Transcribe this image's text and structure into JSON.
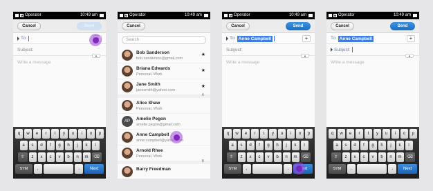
{
  "status": {
    "operator": "Operator",
    "time": "10:49 am",
    "m_badge": "M"
  },
  "topbar": {
    "cancel": "Cancel",
    "send": "Send"
  },
  "compose": {
    "to_label": "To:",
    "subject_label": "Subject:",
    "message_placeholder": "Write a message",
    "recipient_chip": "Anne Campbell",
    "plus": "+",
    "expand": "▼"
  },
  "search": {
    "placeholder": "Search"
  },
  "contacts": [
    {
      "name": "Bob Sanderson",
      "detail": "bob.sanderson@gmail.com",
      "star": "★"
    },
    {
      "name": "Briana Edwards",
      "detail": "Personal, Work",
      "star": "★"
    },
    {
      "name": "Jane Smith",
      "detail": "janesmith@yahoo.com",
      "star": "★"
    },
    {
      "name": "Alice Shaw",
      "detail": "Personal, Work"
    },
    {
      "name": "Amelie Pegon",
      "detail": "amelie.pegon@gmail.com",
      "initials": "AP"
    },
    {
      "name": "Anne Campbell",
      "detail": "anne.campbell@yahoo.com"
    },
    {
      "name": "Arnold Rhee",
      "detail": "Personal, Work"
    },
    {
      "name": "Barry Freedman",
      "detail": ""
    }
  ],
  "index_letters": {
    "a": "A",
    "b": "B"
  },
  "keyboard": {
    "row1": [
      "q",
      "w",
      "e",
      "r",
      "t",
      "y",
      "u",
      "i",
      "o",
      "p"
    ],
    "row2": [
      "a",
      "s",
      "d",
      "f",
      "g",
      "h",
      "j",
      "k",
      "l"
    ],
    "row3": [
      "z",
      "x",
      "c",
      "v",
      "b",
      "n",
      "m"
    ],
    "shift": "⇧",
    "backspace": "⌫",
    "sym": "SYM",
    "comma": ",",
    "period": ".",
    "next": "Next"
  }
}
